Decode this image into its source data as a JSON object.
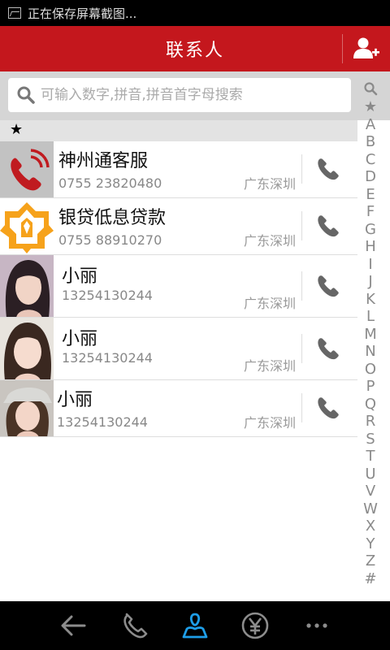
{
  "status_bar": {
    "text": "正在保存屏幕截图..."
  },
  "app_bar": {
    "title": "联系人"
  },
  "search": {
    "placeholder": "可输入数字,拼音,拼音首字母搜索"
  },
  "section": {
    "label": "★"
  },
  "contacts": [
    {
      "name": "神州通客服",
      "phone": "0755 23820480",
      "location": "广东深圳"
    },
    {
      "name": "银贷低息贷款",
      "phone": "0755 88910270",
      "location": "广东深圳"
    },
    {
      "name": "小丽",
      "phone": "13254130244",
      "location": "广东深圳"
    },
    {
      "name": "小丽",
      "phone": "13254130244",
      "location": "广东深圳"
    },
    {
      "name": "小丽",
      "phone": "13254130244",
      "location": "广东深圳"
    }
  ],
  "alphabet": [
    "★",
    "A",
    "B",
    "C",
    "D",
    "E",
    "F",
    "G",
    "H",
    "I",
    "J",
    "K",
    "L",
    "M",
    "N",
    "O",
    "P",
    "Q",
    "R",
    "S",
    "T",
    "U",
    "V",
    "W",
    "X",
    "Y",
    "Z",
    "#"
  ],
  "colors": {
    "accent": "#c4171d",
    "nav_active": "#1e9ee8",
    "nav_icon": "#8c8c8c"
  },
  "icons": {
    "add_contact": "add-contact-icon",
    "search": "search-icon",
    "call": "phone-icon",
    "nav": [
      "back-icon",
      "dialer-icon",
      "contacts-icon",
      "yen-icon",
      "more-icon"
    ]
  }
}
